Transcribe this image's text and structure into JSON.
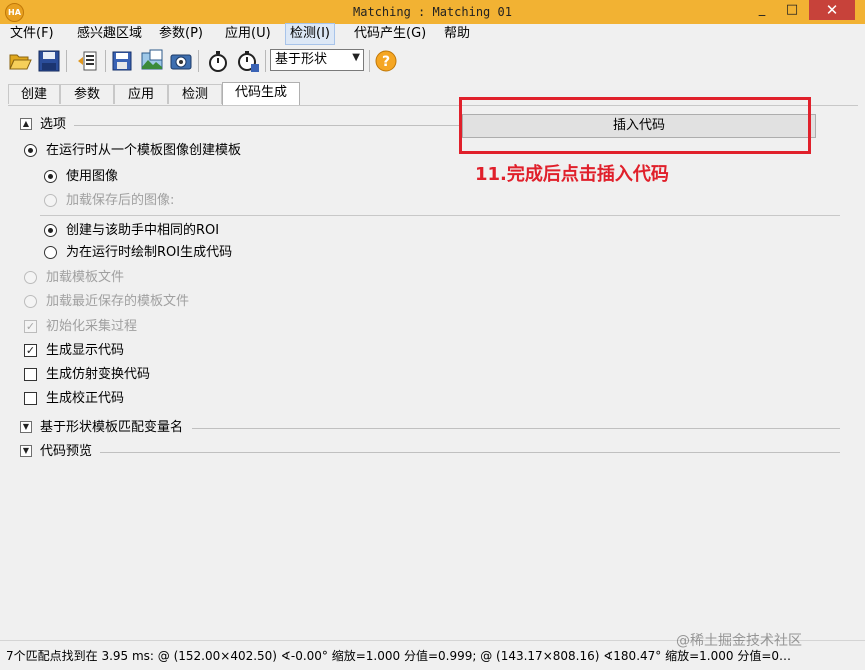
{
  "window": {
    "title": "Matching : Matching 01",
    "app_icon": "HA",
    "minimize": "_",
    "maximize": "□",
    "close": "✕"
  },
  "menu": [
    {
      "label": "文件(F)"
    },
    {
      "label": "感兴趣区域"
    },
    {
      "label": "参数(P)"
    },
    {
      "label": "应用(U)"
    },
    {
      "label": "检测(I)"
    },
    {
      "label": "代码产生(G)"
    },
    {
      "label": "帮助"
    }
  ],
  "toolbar": {
    "icons": [
      "open-folder-icon",
      "save-icon",
      "load-model-icon",
      "save-model-icon",
      "image-icon",
      "camera-icon",
      "timer-icon",
      "timer-settings-icon",
      "help-icon"
    ],
    "combo_value": "基于形状",
    "combo_arrow": "▼",
    "help_glyph": "?"
  },
  "tabs": [
    {
      "label": "创建"
    },
    {
      "label": "参数"
    },
    {
      "label": "应用"
    },
    {
      "label": "检测"
    },
    {
      "label": "代码生成",
      "active": true
    }
  ],
  "sections": {
    "options": {
      "label": "选项",
      "toggle": "▲"
    },
    "variable_names": {
      "label": "基于形状模板匹配变量名",
      "toggle": "▼"
    },
    "code_preview": {
      "label": "代码预览",
      "toggle": "▼"
    }
  },
  "insert_button": "插入代码",
  "annotation": "11.完成后点击插入代码",
  "options": {
    "runtime_create": {
      "label": "在运行时从一个模板图像创建模板",
      "checked": true
    },
    "use_image": {
      "label": "使用图像",
      "checked": true
    },
    "load_saved_image": {
      "label": "加载保存后的图像:",
      "checked": false,
      "disabled": true
    },
    "create_same_roi": {
      "label": "创建与该助手中相同的ROI",
      "checked": true
    },
    "runtime_draw_roi": {
      "label": "为在运行时绘制ROI生成代码",
      "checked": false
    },
    "load_model_file": {
      "label": "加载模板文件",
      "checked": false,
      "disabled": true
    },
    "load_recent_model": {
      "label": "加载最近保存的模板文件",
      "checked": false,
      "disabled": true
    },
    "init_acquisition": {
      "label": "初始化采集过程",
      "checked": true,
      "disabled": true
    },
    "gen_display_code": {
      "label": "生成显示代码",
      "checked": true
    },
    "gen_affine_code": {
      "label": "生成仿射变换代码",
      "checked": false
    },
    "gen_rectify_code": {
      "label": "生成校正代码",
      "checked": false
    }
  },
  "check_mark": "✓",
  "status": "7个匹配点找到在 3.95 ms: @ (152.00×402.50) ∢-0.00°  缩放=1.000 分值=0.999; @ (143.17×808.16) ∢180.47°  缩放=1.000 分值=0…",
  "watermark": "@稀土掘金技术社区",
  "colors": {
    "titlebar": "#f2b233",
    "close_button": "#c7423a",
    "annotation_red": "#e0202b"
  }
}
